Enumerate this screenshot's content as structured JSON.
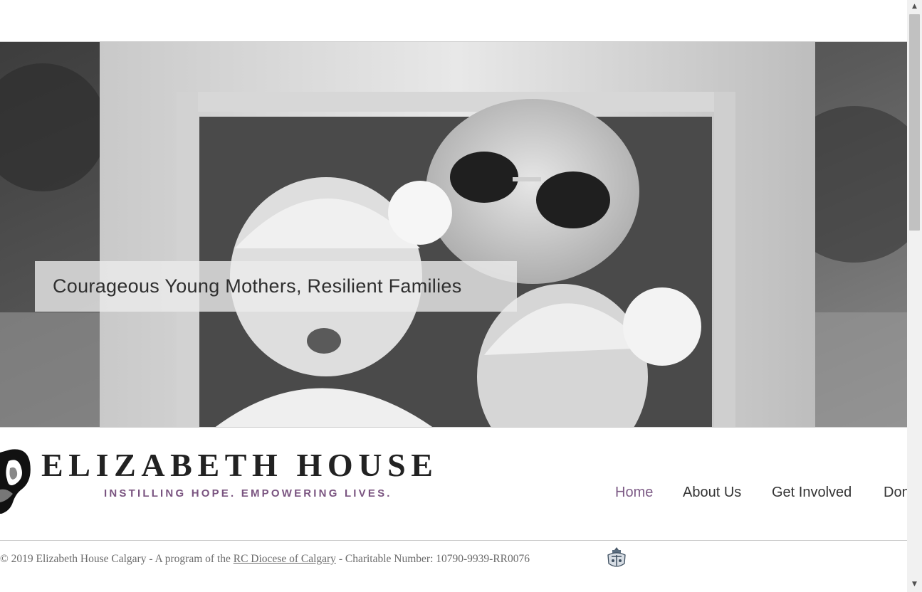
{
  "hero": {
    "caption": "Courageous Young Mothers, Resilient Families",
    "image": "grayscale photo of mother and two babies in white bonnets framed by an ornate picture frame"
  },
  "brand": {
    "name": "ELIZABETH HOUSE",
    "tagline": "INSTILLING HOPE. EMPOWERING LIVES.",
    "logo_icon": "mother-silhouette-icon"
  },
  "nav": {
    "items": [
      {
        "label": "Home",
        "active": true
      },
      {
        "label": "About Us",
        "active": false
      },
      {
        "label": "Get Involved",
        "active": false
      },
      {
        "label": "Donate",
        "active": false
      }
    ]
  },
  "footer": {
    "prefix": "© 2019 Elizabeth House Calgary - A program of the ",
    "link_label": "RC Diocese of Calgary",
    "suffix": " - Charitable Number: 10790-9939-RR0076",
    "crest_icon": "diocese-crest-icon"
  },
  "scrollbar": {
    "up_icon": "scroll-up-arrow-icon",
    "down_icon": "scroll-down-arrow-icon"
  },
  "colors": {
    "accent": "#7d5b86",
    "tagline": "#7a5480",
    "text": "#333333"
  }
}
